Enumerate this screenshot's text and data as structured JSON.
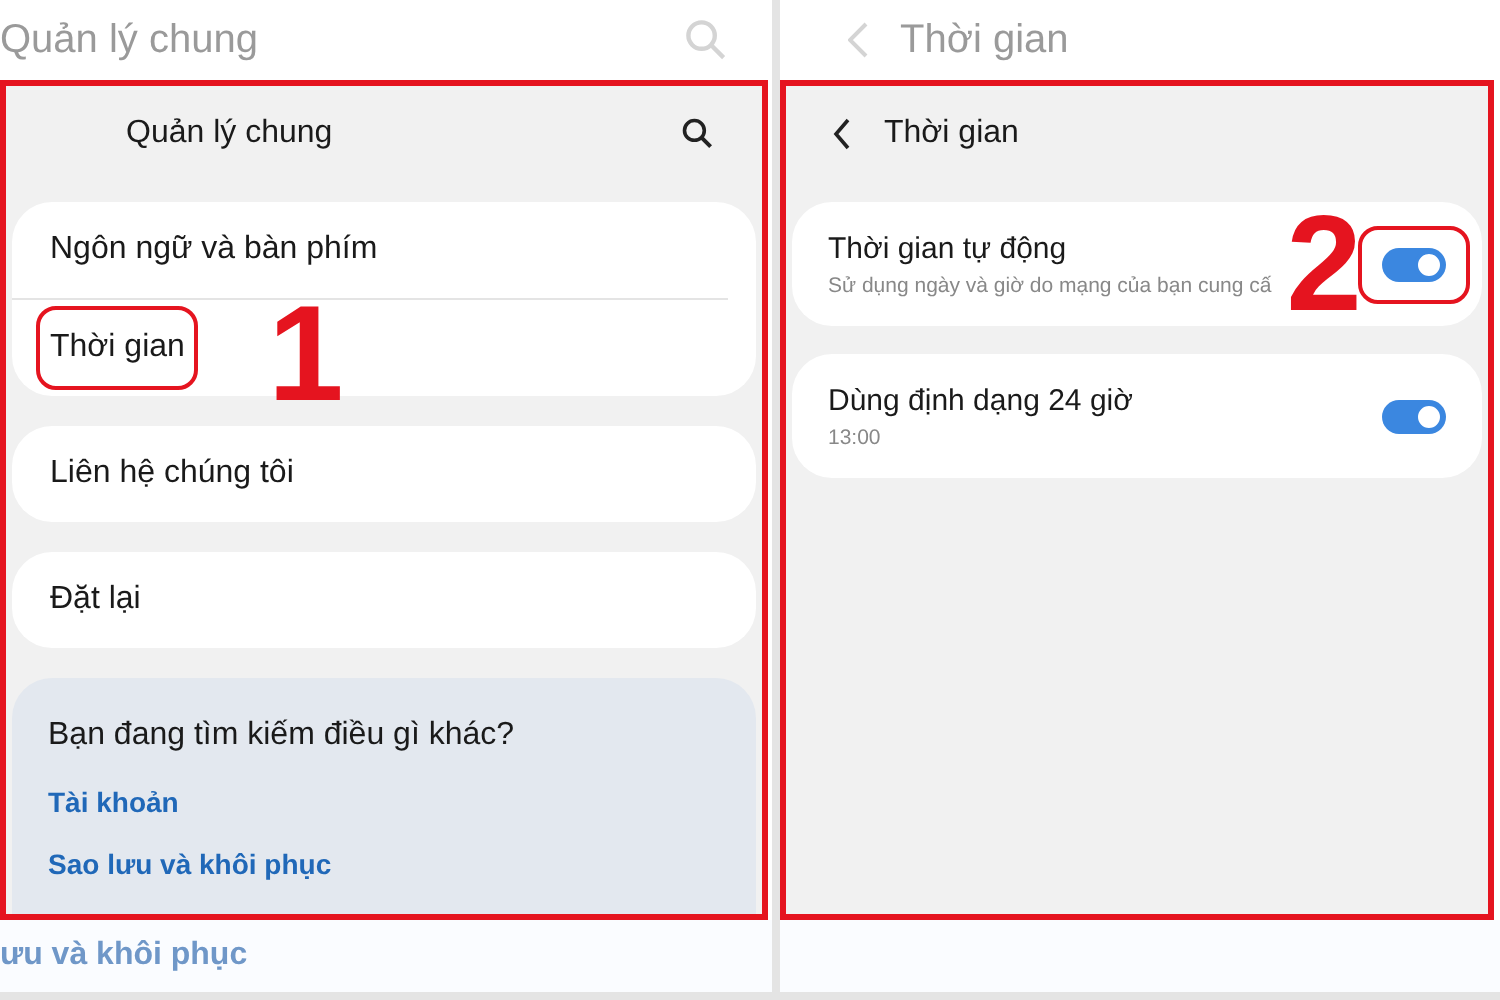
{
  "left_panel": {
    "background_title": "Quản lý chung",
    "title": "Quản lý chung",
    "groups": [
      {
        "items": [
          {
            "label": "Ngôn ngữ và bàn phím",
            "highlighted": false
          },
          {
            "label": "Thời gian",
            "highlighted": true,
            "step": "1"
          }
        ]
      },
      {
        "items": [
          {
            "label": "Liên hệ chúng tôi",
            "highlighted": false
          }
        ]
      },
      {
        "items": [
          {
            "label": "Đặt lại",
            "highlighted": false
          }
        ]
      }
    ],
    "suggestions": {
      "heading": "Bạn đang tìm kiếm điều gì khác?",
      "links": [
        "Tài khoản",
        "Sao lưu và khôi phục"
      ]
    },
    "background_footer": "ưu và khôi phục"
  },
  "right_panel": {
    "background_title": "Thời gian",
    "title": "Thời gian",
    "settings": [
      {
        "title": "Thời gian tự động",
        "subtitle": "Sử dụng ngày và giờ do mạng của bạn cung cấ",
        "on": true,
        "highlighted": true,
        "step": "2"
      },
      {
        "title": "Dùng định dạng 24 giờ",
        "subtitle": "13:00",
        "on": true,
        "highlighted": false
      }
    ]
  }
}
